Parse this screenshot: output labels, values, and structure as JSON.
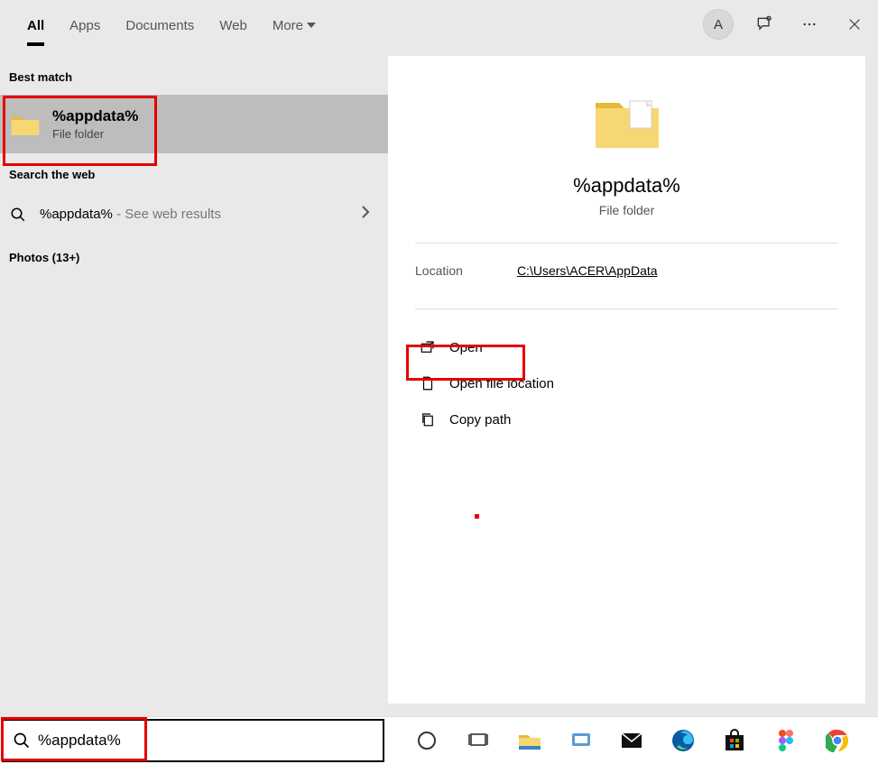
{
  "tabs": {
    "all": "All",
    "apps": "Apps",
    "documents": "Documents",
    "web": "Web",
    "more": "More"
  },
  "avatar_letter": "A",
  "left": {
    "best_match": "Best match",
    "result_title": "%appdata%",
    "result_sub": "File folder",
    "search_web": "Search the web",
    "web_query": "%appdata%",
    "web_suffix": " - See web results",
    "photos": "Photos (13+)"
  },
  "preview": {
    "title": "%appdata%",
    "sub": "File folder",
    "location_label": "Location",
    "location_value": "C:\\Users\\ACER\\AppData",
    "actions": {
      "open": "Open",
      "open_location": "Open file location",
      "copy_path": "Copy path"
    }
  },
  "search": {
    "value": "%appdata%"
  }
}
